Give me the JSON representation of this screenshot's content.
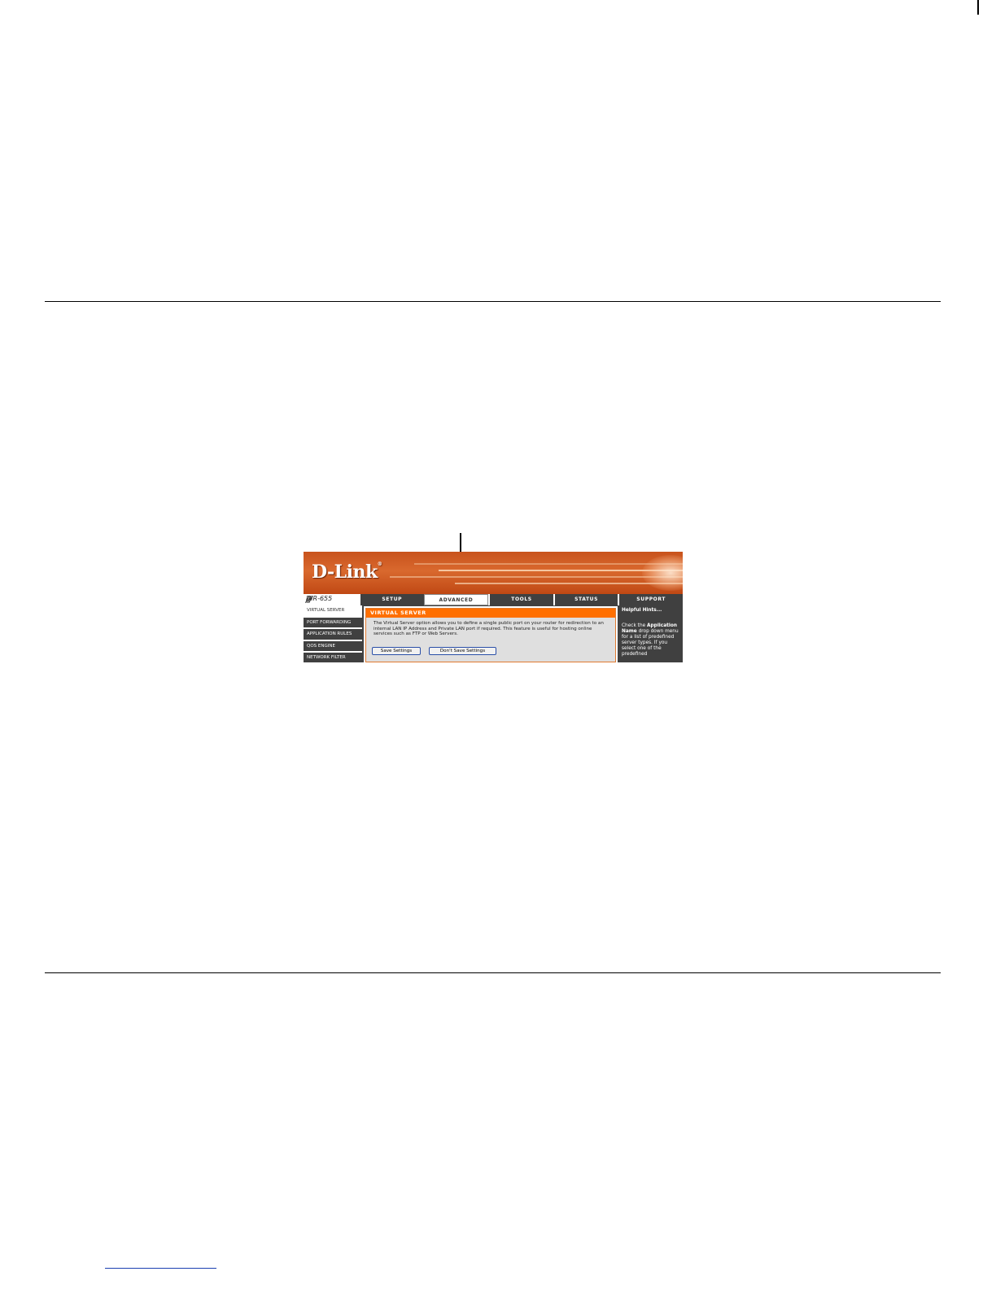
{
  "screenshot": {
    "logo_text": "D-Link",
    "logo_mark": "®",
    "model": "DIR-655",
    "model_slashes": "///",
    "tabs": [
      {
        "label": "SETUP"
      },
      {
        "label": "ADVANCED"
      },
      {
        "label": "TOOLS"
      },
      {
        "label": "STATUS"
      },
      {
        "label": "SUPPORT"
      }
    ],
    "active_tab": "ADVANCED",
    "sidebar": [
      {
        "label": "VIRTUAL SERVER"
      },
      {
        "label": "PORT FORWARDING"
      },
      {
        "label": "APPLICATION RULES"
      },
      {
        "label": "QOS ENGINE"
      },
      {
        "label": "NETWORK FILTER"
      }
    ],
    "panel": {
      "title": "VIRTUAL SERVER",
      "description": "The Virtual Server option allows you to define a single public port on your router for redirection to an internal LAN IP Address and Private LAN port if required. This feature is useful for hosting online services such as FTP or Web Servers.",
      "save_label": "Save Settings",
      "dont_save_label": "Don't Save Settings"
    },
    "hints": {
      "title": "Helpful Hints...",
      "text_1": "Check the ",
      "bold_1": "Application Name",
      "text_2": " drop down menu for a list of predefined server types. If you select one of the predefined"
    }
  },
  "colors": {
    "banner": "#c8521c",
    "panel_title": "#ff6f00",
    "nav_dark": "#404040",
    "button_border": "#2a4fa8"
  }
}
